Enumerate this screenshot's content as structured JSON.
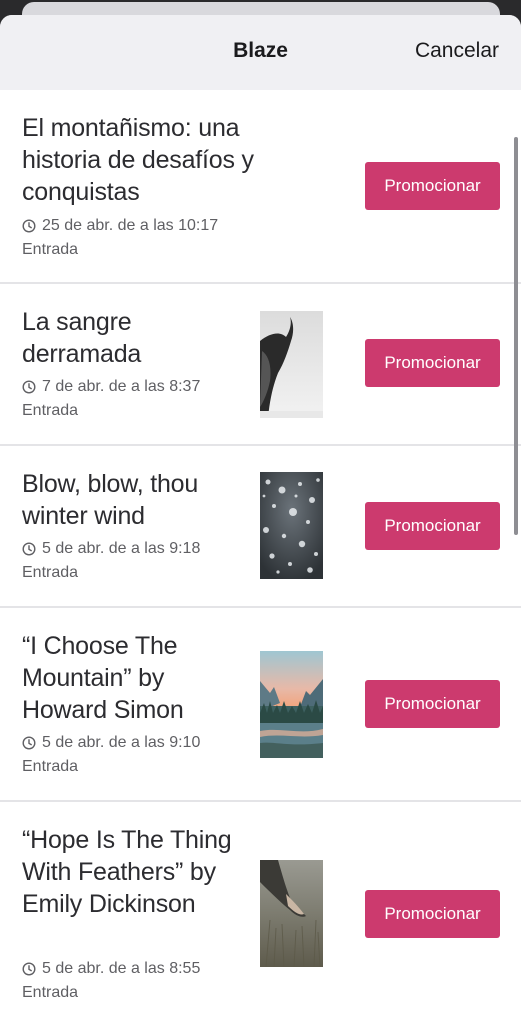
{
  "header": {
    "title": "Blaze",
    "cancel_label": "Cancelar"
  },
  "posts": [
    {
      "title": "El montañismo: una historia de desafíos y conquistas",
      "date": "25 de abr. de a las 10:17",
      "type": "Entrada",
      "button": "Promocionar",
      "has_thumb": false
    },
    {
      "title": "La sangre derramada",
      "date": "7 de abr. de a las 8:37",
      "type": "Entrada",
      "button": "Promocionar",
      "thumb": "bison-photo"
    },
    {
      "title": "Blow, blow, thou winter wind",
      "date": "5 de abr. de a las 9:18",
      "type": "Entrada",
      "button": "Promocionar",
      "thumb": "snowfall-photo"
    },
    {
      "title": "“I Choose The Mountain” by Howard Simon",
      "date": "5 de abr. de a las 9:10",
      "type": "Entrada",
      "button": "Promocionar",
      "thumb": "mountain-lake-photo"
    },
    {
      "title": "“Hope Is The Thing With Feathers” by Emily Dickinson",
      "date": "5 de abr. de a las 8:55",
      "type": "Entrada",
      "button": "Promocionar",
      "thumb": "hand-in-grass-photo"
    }
  ],
  "colors": {
    "accent": "#cc3a6e",
    "header_bg": "#f0f0f3",
    "title_text": "#2c2c30",
    "meta_text": "#5f5f63"
  }
}
